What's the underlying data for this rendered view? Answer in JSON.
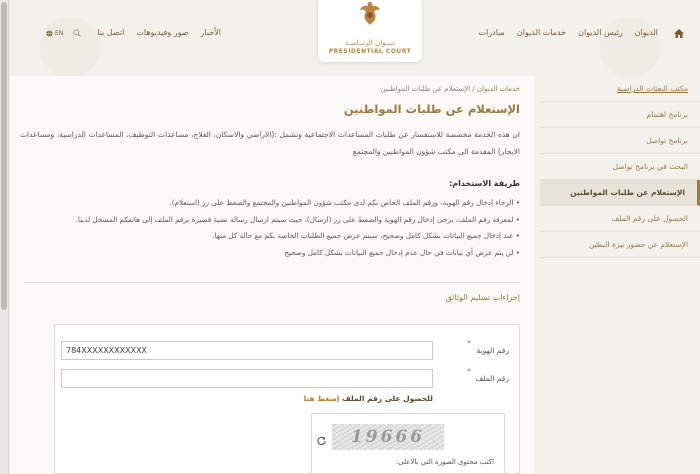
{
  "header": {
    "nav_right": [
      "الديوان",
      "رئيس الديوان",
      "خدمات الديوان",
      "مبادرات"
    ],
    "nav_left": [
      "الأخبار",
      "صور وفيديوهات",
      "اتصل بنا"
    ],
    "logo_ar": "ديــوان الرئــاسـة",
    "logo_en": "PRESIDENTIAL COURT",
    "lang_label": "EN",
    "icons": {
      "home": "home-icon",
      "search": "search-icon",
      "globe": "globe-icon"
    },
    "accent_color": "#a07a3d"
  },
  "sidebar": {
    "items": [
      {
        "label": "مكتب البعثات الدراسية",
        "active": false
      },
      {
        "label": "برنامج اهتمام",
        "active": false
      },
      {
        "label": "برنامج تواصل",
        "active": false
      },
      {
        "label": "البحث في برنامج تواصل",
        "active": false
      },
      {
        "label": "الإستعلام عن طلبات المواطنين",
        "active": true
      },
      {
        "label": "الحصول على رقم الملف",
        "active": false
      },
      {
        "label": "الإستعلام عن حضور بيزة البطين",
        "active": false
      }
    ]
  },
  "main": {
    "breadcrumb": {
      "parent": "خدمات الديوان",
      "separator": "/",
      "current": "الإستعلام عن طلبات المواطنين"
    },
    "title": "الإستعلام عن طلبات المواطنين",
    "intro": "ان هذه الخدمة مخصصة للاستفسار عن طلبات المساعدات الاجتماعية وتشمل :(الاراضي والاسكان، العلاج، مساعدات التوظيف، المساعدات الدراسية، ومساعدات الايجار) المقدمة الى مكتب شؤون المواطنين والمجتمع",
    "usage_heading": "طريقة الاستخدام:",
    "usage_items": [
      "الرجاء إدخال رقم الهوية، ورقم الملف الخاص بكم لدى مكتب شؤون المواطنين والمجتمع والضغط على زر (استعلام).",
      "لمعرفة رقم الملف، يرجى إدخال رقم الهوية والضغط على زر (ارسال)، حيث سيتم ارسال رسالة نصية قصيرة برقم الملف إلى هاتفكم المسجل لدينا.",
      "عند إدخال جميع البيانات بشكل كامل وصحيح، سيتم عرض جميع الطلبات الخاصة بكم مع حالة كل منها.",
      "لن يتم عرض أي بيانات في حال عدم إدخال جميع البيانات بشكل كامل وصحيح"
    ],
    "docs_heading": "إجراءات تسليم الوثائق"
  },
  "form": {
    "id_label": "رقم الهوية",
    "id_value": "784XXXXXXXXXXXX",
    "file_label": "رقم الملف",
    "file_value": "",
    "required_mark": "*",
    "hint_text": "للحصول على رقم الملف",
    "hint_link": "إضغط هنا",
    "captcha_text": "19666",
    "captcha_label": "اكتب محتوى الصورة التي بالاعلى:"
  }
}
